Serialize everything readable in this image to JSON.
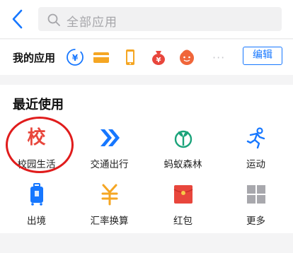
{
  "header": {
    "search_placeholder": "全部应用"
  },
  "my_apps": {
    "title": "我的应用",
    "more": "···",
    "edit_label": "编辑",
    "icons": [
      "yuan-circle-icon",
      "bank-card-icon",
      "phone-topup-icon",
      "money-bag-icon",
      "fortune-smiley-icon"
    ]
  },
  "recent": {
    "title": "最近使用",
    "apps": [
      {
        "label": "校园生活",
        "icon": "campus-life-icon"
      },
      {
        "label": "交通出行",
        "icon": "transport-arrows-icon"
      },
      {
        "label": "蚂蚁森林",
        "icon": "ant-forest-icon"
      },
      {
        "label": "运动",
        "icon": "running-person-icon"
      },
      {
        "label": "出境",
        "icon": "luggage-icon"
      },
      {
        "label": "汇率换算",
        "icon": "exchange-rate-icon"
      },
      {
        "label": "红包",
        "icon": "red-envelope-icon"
      },
      {
        "label": "更多",
        "icon": "more-grid-icon"
      }
    ],
    "campus_glyph": "校"
  },
  "colors": {
    "accent": "#1677ff",
    "orange": "#f5a623",
    "red": "#e8463c",
    "teal": "#1aa37a",
    "annotation": "#e01c1c"
  }
}
